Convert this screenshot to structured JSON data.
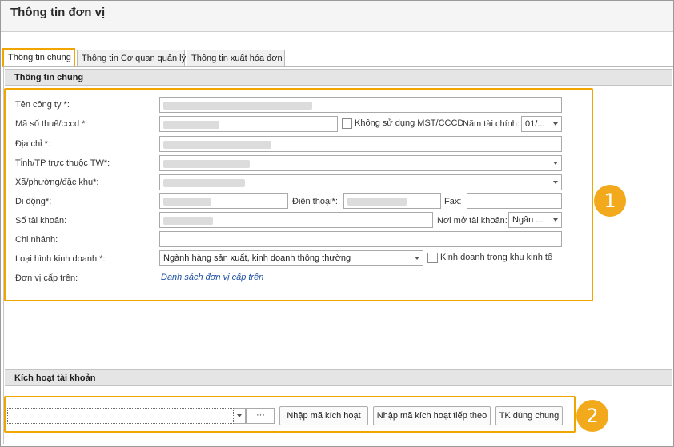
{
  "window": {
    "title": "Thông tin đơn vị"
  },
  "tabs": [
    {
      "label": "Thông tin chung",
      "active": true
    },
    {
      "label": "Thông tin Cơ quan quản lý",
      "active": false
    },
    {
      "label": "Thông tin xuất hóa đơn",
      "active": false
    }
  ],
  "general": {
    "header": "Thông tin chung",
    "company_name_label": "Tên công ty *:",
    "tax_code_label": "Mã số thuế/cccd *:",
    "no_tax_code_label": "Không sử dụng MST/CCCD",
    "fiscal_year_label": "Năm tài chính:",
    "fiscal_year_value": "01/...",
    "address_label": "Địa chỉ *:",
    "province_label": "Tỉnh/TP trực thuộc TW*:",
    "ward_label": "Xã/phường/đặc khu*:",
    "mobile_label": "Di động*:",
    "phone_label": "Điện thoại*:",
    "fax_label": "Fax:",
    "account_no_label": "Số tài khoản:",
    "bank_label": "Nơi mở tài khoản:",
    "bank_value": "Ngân ...",
    "branch_label": "Chi nhánh:",
    "business_type_label": "Loại hình kinh doanh *:",
    "business_type_value": "Ngành hàng sản xuất, kinh doanh thông thường",
    "economic_zone_label": "Kinh doanh trong khu kinh tế",
    "parent_unit_label": "Đơn vị cấp trên:",
    "parent_unit_link": "Danh sách đơn vị cấp trên"
  },
  "activation": {
    "header": "Kích hoạt tài khoản",
    "ellipsis": "···",
    "enter_code_button": "Nhập mã kích hoạt",
    "enter_next_code_button": "Nhập mã kích hoạt tiếp theo",
    "shared_account_button": "TK dùng chung"
  },
  "badges": {
    "one": "1",
    "two": "2"
  },
  "colors": {
    "highlight": "#f0a500",
    "badge": "#f2aa1c",
    "link": "#1a4ea0"
  }
}
